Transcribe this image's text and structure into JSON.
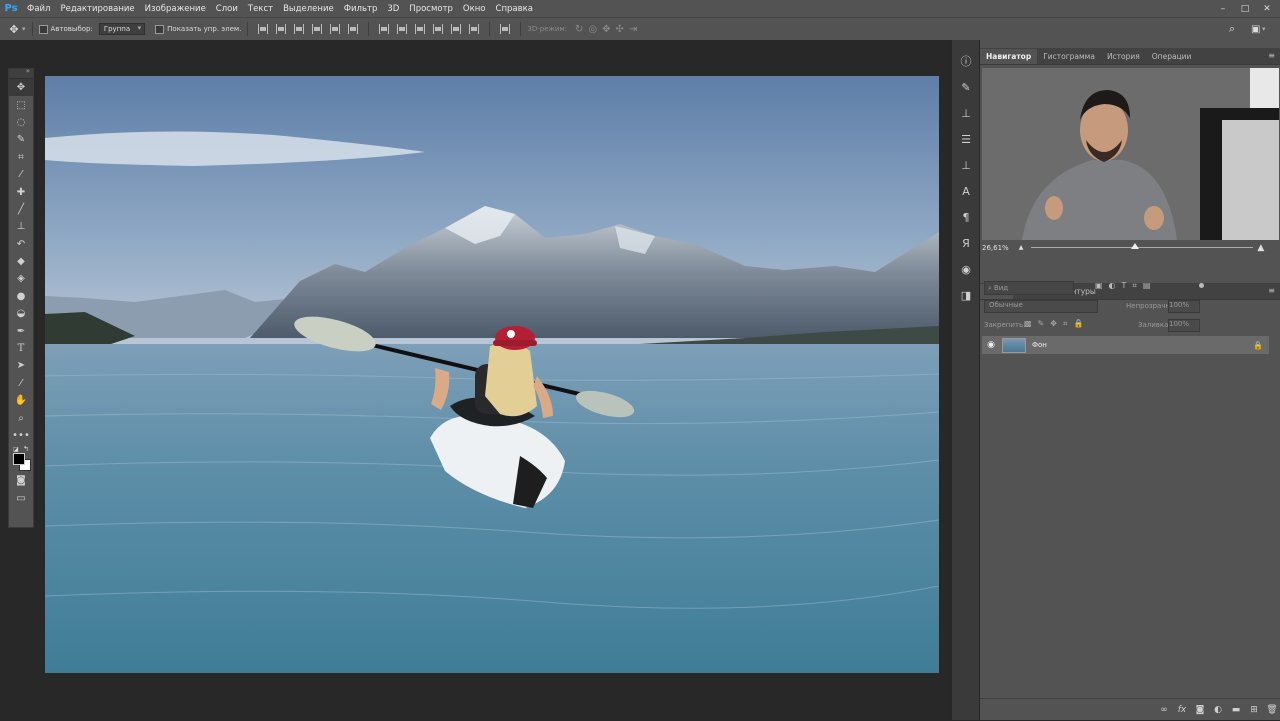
{
  "app": {
    "logo": "Ps"
  },
  "menu": [
    "Файл",
    "Редактирование",
    "Изображение",
    "Слои",
    "Текст",
    "Выделение",
    "Фильтр",
    "3D",
    "Просмотр",
    "Окно",
    "Справка"
  ],
  "window_controls": {
    "minimize": "–",
    "maximize": "□",
    "close": "✕"
  },
  "options": {
    "autoselect_label": "Автовыбор:",
    "autoselect_value": "Группа",
    "show_controls_label": "Показать упр. элем.",
    "mode3d_label": "3D-режим:"
  },
  "tools": [
    "move",
    "marquee",
    "lasso",
    "quick-selection",
    "crop",
    "eyedropper",
    "healing-brush",
    "brush",
    "clone-stamp",
    "history-brush",
    "eraser",
    "paint-bucket",
    "blur",
    "dodge",
    "pen",
    "type",
    "path-selection",
    "line",
    "hand",
    "zoom",
    "more"
  ],
  "panel_tabs_top": [
    {
      "label": "Навигатор",
      "active": true
    },
    {
      "label": "Гистограмма",
      "active": false
    },
    {
      "label": "История",
      "active": false
    },
    {
      "label": "Операции",
      "active": false
    }
  ],
  "navigator": {
    "zoom": "26,61%",
    "zoom_fraction": 0.45
  },
  "panel_tabs_layers": [
    {
      "label": "Слои",
      "active": true
    },
    {
      "label": "Каналы",
      "active": false
    },
    {
      "label": "Контуры",
      "active": false
    }
  ],
  "layers": {
    "filter_placeholder": "Вид",
    "blend_mode": "Обычные",
    "opacity_label": "Непрозрачность:",
    "opacity_value": "100%",
    "lock_label": "Закрепить:",
    "fill_label": "Заливка:",
    "fill_value": "100%",
    "items": [
      {
        "name": "Фон",
        "visible": true,
        "locked": true
      }
    ]
  },
  "colors": {
    "panel": "#535353",
    "dark": "#282828",
    "accent": "#31a8ff"
  }
}
